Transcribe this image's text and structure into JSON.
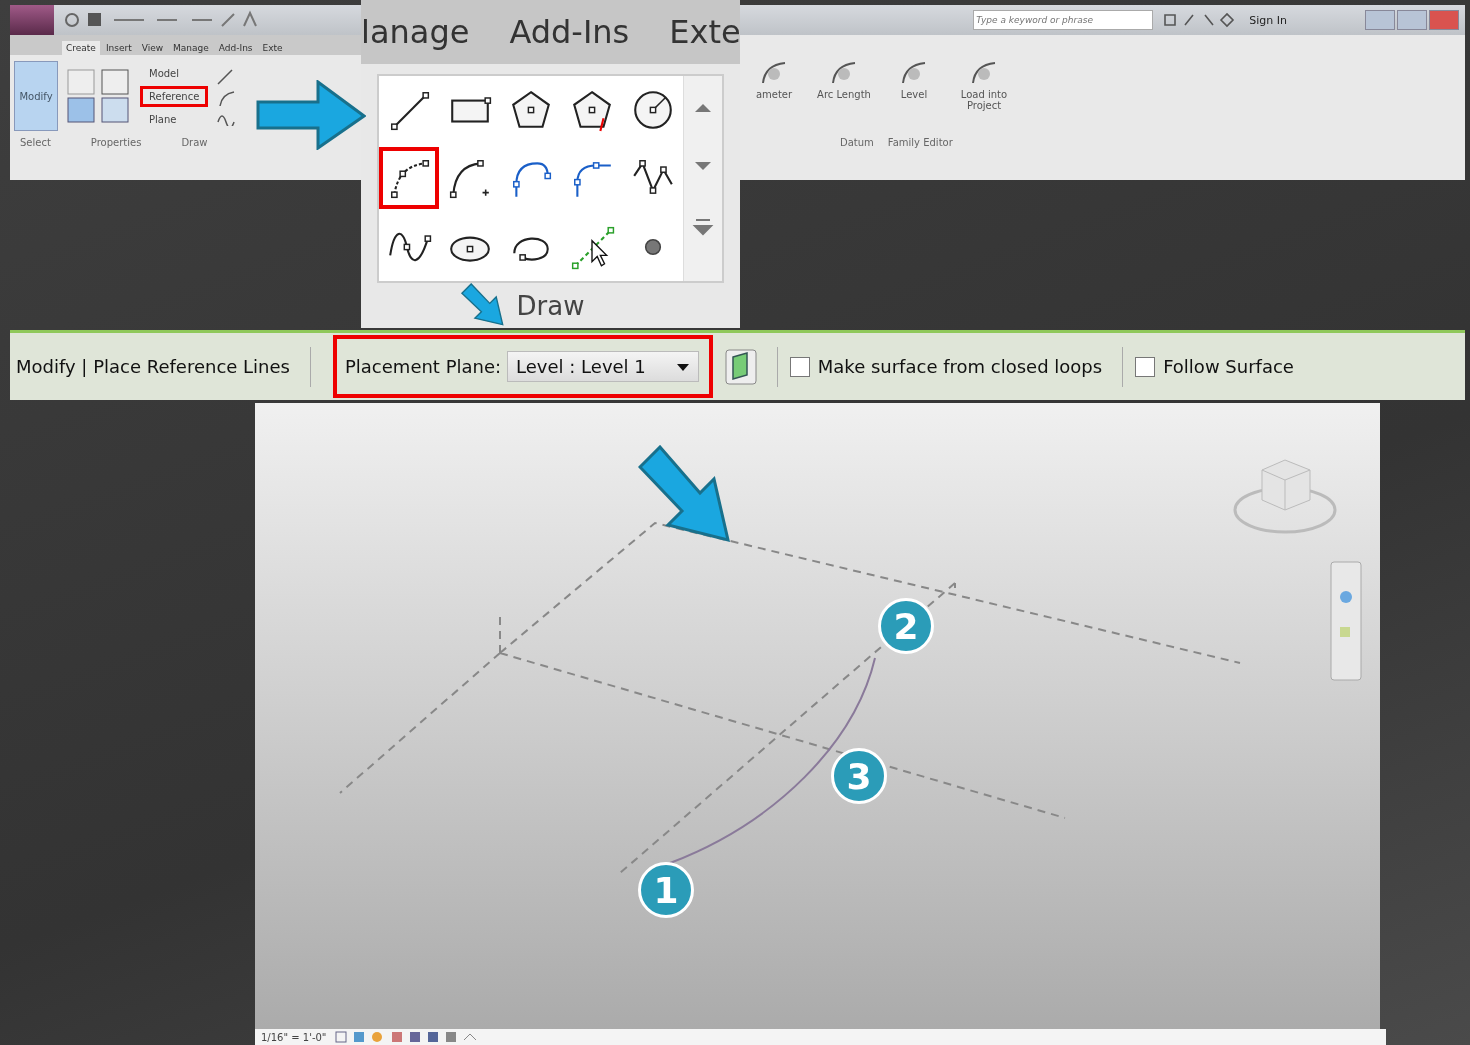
{
  "ribbon": {
    "tabs": [
      {
        "label": "Create",
        "selected": true
      },
      {
        "label": "Insert",
        "selected": false
      },
      {
        "label": "View",
        "selected": false
      },
      {
        "label": "Manage",
        "selected": false
      },
      {
        "label": "Add-Ins",
        "selected": false
      },
      {
        "label": "Exte",
        "selected": false
      }
    ],
    "search": {
      "placeholder": "Type a keyword or phrase"
    },
    "sign_in": "Sign In",
    "modify_button": "Modify",
    "datum_tools": [
      {
        "label": "Model",
        "highlighted": false
      },
      {
        "label": "Reference",
        "highlighted": true
      },
      {
        "label": "Plane",
        "highlighted": false
      }
    ],
    "panel_labels": [
      "Select",
      "Properties",
      "Draw"
    ],
    "right_tools": [
      {
        "label": "ameter"
      },
      {
        "label": "Arc Length"
      },
      {
        "label": "Level"
      },
      {
        "label": "Load into Project"
      }
    ],
    "right_panel_labels": [
      "Datum",
      "Family Editor"
    ]
  },
  "draw_panel": {
    "tabs": [
      "lanage",
      "Add-Ins",
      "Exte"
    ],
    "tools": [
      {
        "kind": "line",
        "highlighted": false
      },
      {
        "kind": "rectangle",
        "highlighted": false
      },
      {
        "kind": "polygon",
        "highlighted": false
      },
      {
        "kind": "circumscribed-polygon",
        "highlighted": false
      },
      {
        "kind": "circle",
        "highlighted": false
      },
      {
        "kind": "arc",
        "highlighted": true
      },
      {
        "kind": "center-arc",
        "highlighted": false
      },
      {
        "kind": "tangent-arc",
        "highlighted": false
      },
      {
        "kind": "fillet-arc",
        "highlighted": false
      },
      {
        "kind": "spline",
        "highlighted": false
      },
      {
        "kind": "wave",
        "highlighted": false
      },
      {
        "kind": "ellipse",
        "highlighted": false
      },
      {
        "kind": "partial-ellipse",
        "highlighted": false
      },
      {
        "kind": "pick-lines",
        "highlighted": false
      },
      {
        "kind": "point",
        "highlighted": false
      }
    ],
    "label": "Draw"
  },
  "options_bar": {
    "title": "Modify | Place Reference Lines",
    "placement_plane": {
      "label": "Placement Plane:",
      "value": "Level : Level 1",
      "highlighted": true
    },
    "checkboxes": [
      {
        "label": "Make surface from closed loops",
        "checked": false
      },
      {
        "label": "Follow Surface",
        "checked": false
      }
    ]
  },
  "viewport": {
    "scale": "1/16\" = 1'-0\"",
    "markers": [
      "1",
      "2",
      "3"
    ]
  }
}
